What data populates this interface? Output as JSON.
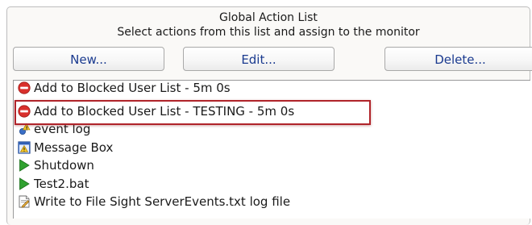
{
  "header": {
    "title": "Global Action List",
    "subtitle": "Select actions from this list and assign to the monitor"
  },
  "buttons": {
    "new_label": "New...",
    "edit_label": "Edit...",
    "delete_label": "Delete..."
  },
  "actions": [
    {
      "label": "Add to Blocked User List - 5m 0s",
      "icon": "blocked-icon"
    },
    {
      "label": "Add to Blocked User List - TESTING - 5m 0s",
      "icon": "blocked-icon",
      "highlighted": true
    },
    {
      "label": "event log",
      "icon": "event-log-icon"
    },
    {
      "label": "Message Box",
      "icon": "message-box-icon"
    },
    {
      "label": "Shutdown",
      "icon": "play-arrow-icon"
    },
    {
      "label": "Test2.bat",
      "icon": "play-arrow-icon"
    },
    {
      "label": "Write to File Sight ServerEvents.txt log file",
      "icon": "write-file-icon"
    }
  ],
  "colors": {
    "highlight_border": "#b0242a",
    "button_text": "#1a3a8f",
    "blocked_icon": "#d9302c",
    "play_icon": "#2fa12f"
  }
}
